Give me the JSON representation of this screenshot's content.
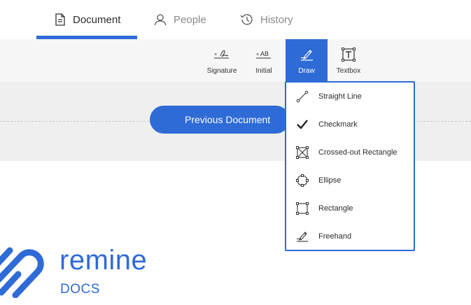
{
  "tabs": [
    {
      "label": "Document",
      "icon": "document-icon",
      "active": true
    },
    {
      "label": "People",
      "icon": "person-icon",
      "active": false
    },
    {
      "label": "History",
      "icon": "history-icon",
      "active": false
    }
  ],
  "toolbar": {
    "signature_label": "Signature",
    "initial_label": "Initial",
    "draw_label": "Draw",
    "textbox_label": "Textbox"
  },
  "document": {
    "previous_button": "Previous Document"
  },
  "draw_menu": {
    "items": [
      {
        "label": "Straight Line",
        "icon": "straight-line-icon"
      },
      {
        "label": "Checkmark",
        "icon": "checkmark-icon"
      },
      {
        "label": "Crossed-out Rectangle",
        "icon": "crossed-rectangle-icon"
      },
      {
        "label": "Ellipse",
        "icon": "ellipse-icon"
      },
      {
        "label": "Rectangle",
        "icon": "rectangle-icon"
      },
      {
        "label": "Freehand",
        "icon": "freehand-icon"
      }
    ]
  },
  "logo": {
    "word": "remine",
    "sub": "DOCS"
  },
  "colors": {
    "accent": "#2f6bd6",
    "toolbar_bg": "#f6f6f6",
    "band_bg": "#efefef"
  }
}
